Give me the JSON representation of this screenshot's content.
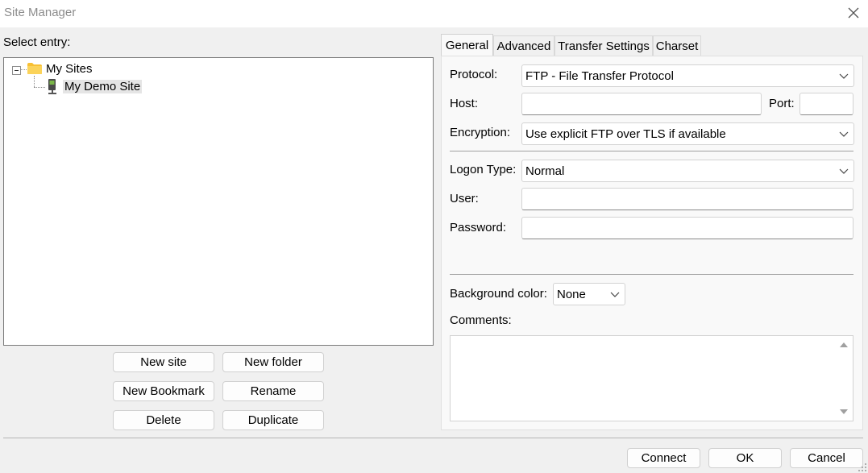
{
  "window": {
    "title": "Site Manager"
  },
  "left": {
    "select_entry_label": "Select entry:",
    "tree": {
      "folder_label": "My Sites",
      "site_label": "My Demo Site"
    },
    "buttons": {
      "new_site": "New site",
      "new_folder": "New folder",
      "new_bookmark": "New Bookmark",
      "rename": "Rename",
      "delete": "Delete",
      "duplicate": "Duplicate"
    }
  },
  "tabs": [
    "General",
    "Advanced",
    "Transfer Settings",
    "Charset"
  ],
  "general": {
    "protocol_label": "Protocol:",
    "protocol_value": "FTP - File Transfer Protocol",
    "host_label": "Host:",
    "host_value": "",
    "port_label": "Port:",
    "port_value": "",
    "encryption_label": "Encryption:",
    "encryption_value": "Use explicit FTP over TLS if available",
    "logon_type_label": "Logon Type:",
    "logon_type_value": "Normal",
    "user_label": "User:",
    "user_value": "",
    "password_label": "Password:",
    "password_value": "",
    "background_color_label": "Background color:",
    "background_color_value": "None",
    "comments_label": "Comments:"
  },
  "footer": {
    "connect": "Connect",
    "ok": "OK",
    "cancel": "Cancel"
  },
  "icons": [
    "close-icon",
    "folder-icon",
    "server-icon",
    "chevron-down-icon",
    "scroll-up-icon",
    "scroll-down-icon",
    "resize-grip-icon"
  ],
  "colors": {
    "window_bg": "#f0f0f0",
    "titlebar_bg": "#ffffff",
    "folder_yellow": "#f8c033",
    "selection_bg": "#e5e5e5"
  }
}
